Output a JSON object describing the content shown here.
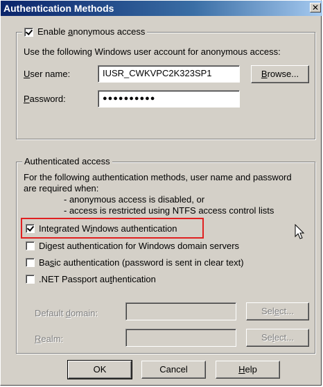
{
  "dialog": {
    "title": "Authentication Methods",
    "close_symbol": "✕"
  },
  "anonymous": {
    "checkbox_checked": true,
    "enable_label_pre": "Enable ",
    "enable_label_u": "a",
    "enable_label_post": "nonymous access",
    "description": "Use the following Windows user account for anonymous access:",
    "username_label_u": "U",
    "username_label_post": "ser name:",
    "username_value": "IUSR_CWKVPC2K323SP1",
    "password_label_u": "P",
    "password_label_post": "assword:",
    "password_value": "●●●●●●●●●●",
    "browse_label_u": "B",
    "browse_label_post": "rowse..."
  },
  "authenticated": {
    "legend": "Authenticated access",
    "intro_line1": "For the following authentication methods, user name and password",
    "intro_line2": "are required when:",
    "bullet1": "- anonymous access is disabled, or",
    "bullet2": "- access is restricted using NTFS access control lists",
    "methods": [
      {
        "pre": "Integrated W",
        "u": "i",
        "post": "ndows authentication",
        "checked": true
      },
      {
        "pre": "Di",
        "u": "g",
        "post": "est authentication for Windows domain servers",
        "checked": false
      },
      {
        "pre": "Ba",
        "u": "s",
        "post": "ic authentication (password is sent in clear text)",
        "checked": false
      },
      {
        "pre": ".NET Passport au",
        "u": "t",
        "post": "hentication",
        "checked": false
      }
    ],
    "default_domain_label_pre": "Default ",
    "default_domain_label_u": "d",
    "default_domain_label_post": "omain:",
    "default_domain_value": "",
    "realm_label_u": "R",
    "realm_label_post": "ealm:",
    "realm_value": "",
    "select1_pre": "Sel",
    "select1_u": "e",
    "select1_post": "ct...",
    "select2_pre": "Se",
    "select2_u": "l",
    "select2_post": "ect..."
  },
  "footer": {
    "ok_label": "OK",
    "cancel_label": "Cancel",
    "help_label_u": "H",
    "help_label_post": "elp"
  },
  "colors": {
    "title_start": "#0a246a",
    "title_end": "#a6caf0",
    "face": "#d4d0c8",
    "highlight_box": "#e02020"
  }
}
